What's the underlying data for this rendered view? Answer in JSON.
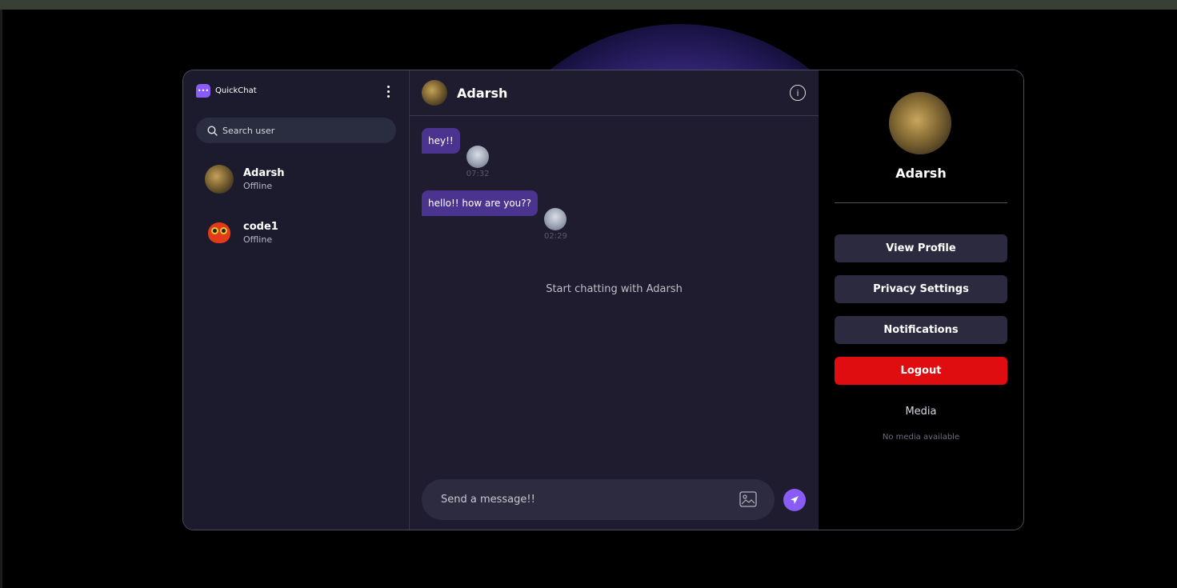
{
  "app": {
    "name": "QuickChat",
    "accent": "#8a5cf6"
  },
  "sidebar": {
    "search_placeholder": "Search user",
    "users": [
      {
        "name": "Adarsh",
        "status": "Offline"
      },
      {
        "name": "code1",
        "status": "Offline"
      }
    ]
  },
  "chat": {
    "title": "Adarsh",
    "messages": [
      {
        "text": "hey!!",
        "time": "07:32"
      },
      {
        "text": "hello!! how are you??",
        "time": "02:29"
      }
    ],
    "empty_note": "Start chatting with Adarsh",
    "composer_placeholder": "Send a message!!"
  },
  "panel": {
    "name": "Adarsh",
    "buttons": [
      "View Profile",
      "Privacy Settings",
      "Notifications",
      "Logout"
    ],
    "logout_color": "#e00d10",
    "media_title": "Media",
    "media_note": "No media available"
  }
}
